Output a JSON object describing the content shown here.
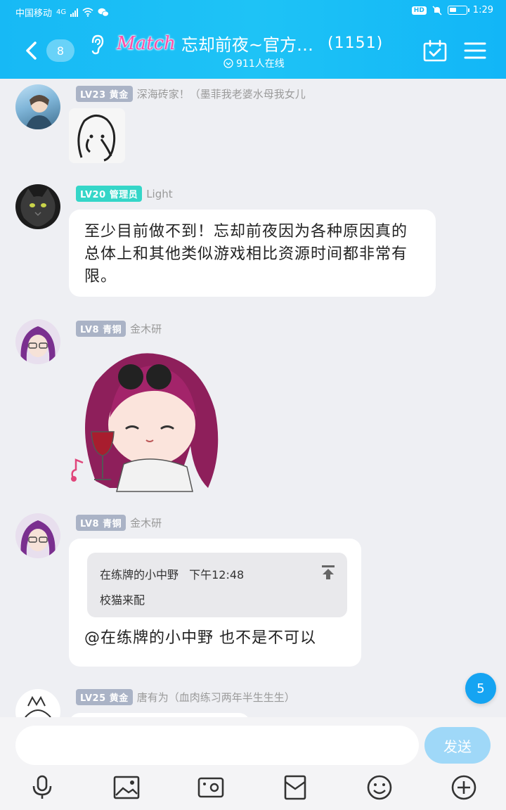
{
  "status_bar": {
    "carrier": "中国移动",
    "network": "4G",
    "hd": "HD",
    "battery_percent": 40,
    "time": "1:29"
  },
  "header": {
    "unread_count": "8",
    "title_prefix": "Match",
    "title": "忘却前夜~官方…",
    "member_count": "(1151)",
    "online_text": "911人在线"
  },
  "messages": [
    {
      "level": "LV23",
      "title": "黄金",
      "name": "深海砖家！（墨菲我老婆水母我女儿",
      "type": "sticker"
    },
    {
      "level": "LV20",
      "title": "管理员",
      "name": "Light",
      "type": "text",
      "text": "至少目前做不到！忘却前夜因为各种原因真的总体上和其他类似游戏相比资源时间都非常有限。"
    },
    {
      "level": "LV8",
      "title": "青铜",
      "name": "金木研",
      "type": "sticker"
    },
    {
      "level": "LV8",
      "title": "青铜",
      "name": "金木研",
      "type": "reply",
      "quote_author": "在练牌的小中野",
      "quote_time": "下午12:48",
      "quote_text": "校猫来配",
      "text": "@在练牌的小中野 也不是不可以"
    },
    {
      "level": "LV25",
      "title": "黄金",
      "name": "唐有为（血肉练习两年半生生生）",
      "type": "partial"
    }
  ],
  "new_message_badge": "5",
  "input": {
    "placeholder": "",
    "send_label": "发送"
  },
  "toolbar_icons": [
    "microphone-icon",
    "image-icon",
    "video-icon",
    "red-packet-icon",
    "emoji-icon",
    "plus-icon"
  ],
  "colors": {
    "header": "#1ec3f6",
    "level_gray": "#aab3c6",
    "level_admin": "#35d6c8",
    "badge": "#15a4f2",
    "send_button": "#9fd8f8"
  }
}
